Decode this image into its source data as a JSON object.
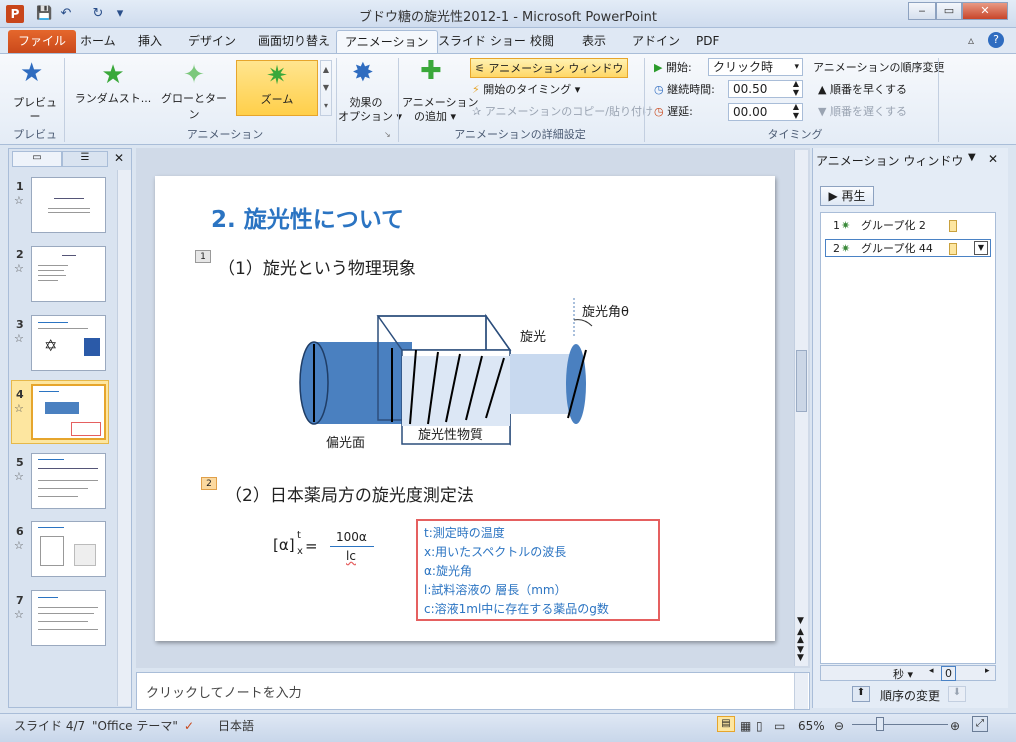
{
  "window": {
    "title": "ブドウ糖の旋光性2012-1 - Microsoft PowerPoint",
    "app_icon": "P",
    "minimize": "‒",
    "maximize": "▭",
    "close": "✕"
  },
  "qat": {
    "save": "💾",
    "undo": "↶",
    "redo": "↻",
    "more": "▾"
  },
  "tabs": [
    "ファイル",
    "ホーム",
    "挿入",
    "デザイン",
    "画面切り替え",
    "アニメーション",
    "スライド ショー",
    "校閲",
    "表示",
    "アドイン",
    "PDF"
  ],
  "ribbon": {
    "preview_label": "プレビュー",
    "preview_group": "プレビュー",
    "gallery": [
      "ランダムスト...",
      "グローとターン",
      "ズーム"
    ],
    "effect_options": "効果の\nオプション ▾",
    "animation_group": "アニメーション",
    "add_animation": "アニメーション\nの追加 ▾",
    "anim_pane": "アニメーション ウィンドウ",
    "start_timing": "開始のタイミング ▾",
    "copy_paste": "アニメーションのコピー/貼り付け",
    "advanced_group": "アニメーションの詳細設定",
    "start_label": "開始:",
    "start_value": "クリック時",
    "duration_label": "継続時間:",
    "duration_value": "00.50",
    "delay_label": "遅延:",
    "delay_value": "00.00",
    "timing_group": "タイミング",
    "reorder_title": "アニメーションの順序変更",
    "move_earlier": "順番を早くする",
    "move_later": "順番を遅くする"
  },
  "thumbnails": [
    {
      "num": "1",
      "star": "☆"
    },
    {
      "num": "2",
      "star": "☆"
    },
    {
      "num": "3",
      "star": "☆"
    },
    {
      "num": "4",
      "star": "☆"
    },
    {
      "num": "5",
      "star": "☆"
    },
    {
      "num": "6",
      "star": "☆"
    },
    {
      "num": "7",
      "star": "☆"
    }
  ],
  "slide": {
    "title": "2. 旋光性について",
    "tag1": "1",
    "heading1": "（1）旋光という物理現象",
    "label_angle": "旋光角θ",
    "label_rotation": "旋光",
    "label_polarizer": "偏光面",
    "label_substance": "旋光性物質",
    "tag2": "2",
    "heading2": "（2）日本薬局方の旋光度測定法",
    "formula_lhs": "[α]",
    "formula_sup": "t",
    "formula_sub": "x",
    "formula_eq": "=",
    "formula_num": "100α",
    "formula_den": "lc",
    "definitions": [
      "t:測定時の温度",
      "x:用いたスペクトルの波長",
      "α:旋光角",
      "l:試料溶液の 層長（mm）",
      "c:溶液1ml中に存在する薬品のg数"
    ]
  },
  "notes_placeholder": "クリックしてノートを入力",
  "anim_pane": {
    "title": "アニメーション ウィンドウ",
    "play": "▶ 再生",
    "items": [
      {
        "num": "1",
        "label": "グループ化 2"
      },
      {
        "num": "2",
        "label": "グループ化 44"
      }
    ],
    "seconds": "秒 ▾",
    "zero": "0",
    "reorder": "順序の変更"
  },
  "status": {
    "slide": "スライド 4/7",
    "theme": "\"Office テーマ\"",
    "language": "日本語",
    "zoom": "65%"
  },
  "colors": {
    "accent": "#2b74c2",
    "file_tab": "#c9471a",
    "selected": "#fde6a0"
  }
}
